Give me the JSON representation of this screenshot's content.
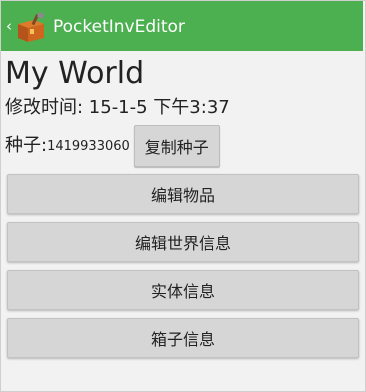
{
  "actionbar": {
    "back_glyph": "‹",
    "title": "PocketInvEditor",
    "icon": "treasure-chest-icon",
    "color": "#4caf50"
  },
  "world": {
    "name": "My World",
    "modified": "修改时间: 15-1-5 下午3:37",
    "seed_label": "种子:",
    "seed_value": "1419933060",
    "copy_seed_label": "复制种子"
  },
  "menu": [
    {
      "label": "编辑物品"
    },
    {
      "label": "编辑世界信息"
    },
    {
      "label": "实体信息"
    },
    {
      "label": "箱子信息"
    }
  ]
}
